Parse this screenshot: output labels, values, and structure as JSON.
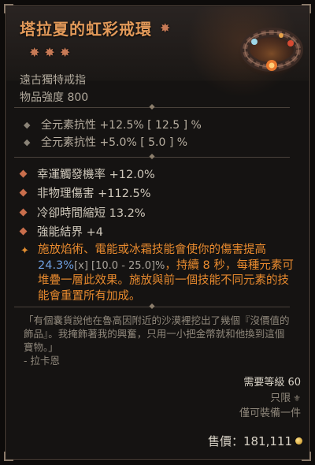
{
  "item": {
    "name": "塔拉夏的虹彩戒環",
    "type": "遠古獨特戒指",
    "power": "物品強度 800"
  },
  "implicits": [
    "全元素抗性 +12.5% [ 12.5 ] %",
    "全元素抗性 +5.0% [ 5.0 ] %"
  ],
  "affixes": [
    "幸運觸發機率 +12.0%",
    "非物理傷害 +112.5%",
    "冷卻時間縮短 13.2%",
    "強能結界 +4"
  ],
  "legendary": {
    "part1": "施放焰術、電能或冰霜技能會使你的傷害提高 ",
    "roll": "24.3%",
    "range": "[x] [10.0 - 25.0]%",
    "part2": "，持續 8 秒，每種元素可堆疊一層此效果。施放與前一個技能不同元素的技能會重置所有加成。"
  },
  "flavor": {
    "text": "「有個囊貨說他在魯高因附近的沙漠裡挖出了幾個『沒價值的飾品』。我掩飾著我的興奮，只用一小把金幣就和他換到這個寶物。」",
    "author": "- 拉卡恩"
  },
  "requirements": {
    "level": "需要等級 60",
    "restriction": "只限",
    "equip_note": "僅可裝備一件"
  },
  "price": "售價：181,111",
  "colors": {
    "unique_title": "#e39a5a",
    "legendary_text": "#e88a2e",
    "roll_value": "#6f9fe0",
    "affix_bullet": "#c96e4c"
  },
  "icons": {
    "title_star": "star-icon",
    "item_art": "ring-icon",
    "currency": "gold-coin-icon"
  }
}
